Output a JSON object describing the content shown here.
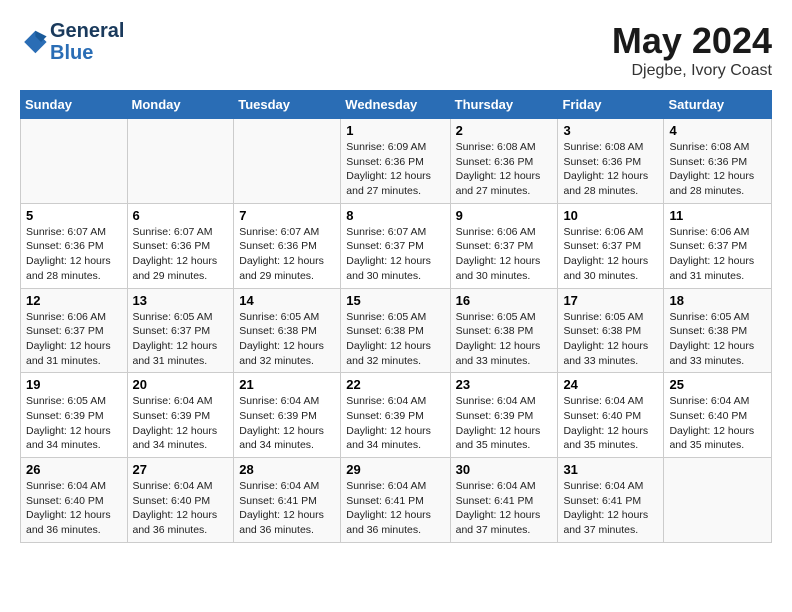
{
  "header": {
    "logo_line1": "General",
    "logo_line2": "Blue",
    "month_title": "May 2024",
    "location": "Djegbe, Ivory Coast"
  },
  "calendar": {
    "weekdays": [
      "Sunday",
      "Monday",
      "Tuesday",
      "Wednesday",
      "Thursday",
      "Friday",
      "Saturday"
    ],
    "weeks": [
      [
        {
          "day": "",
          "info": ""
        },
        {
          "day": "",
          "info": ""
        },
        {
          "day": "",
          "info": ""
        },
        {
          "day": "1",
          "info": "Sunrise: 6:09 AM\nSunset: 6:36 PM\nDaylight: 12 hours\nand 27 minutes."
        },
        {
          "day": "2",
          "info": "Sunrise: 6:08 AM\nSunset: 6:36 PM\nDaylight: 12 hours\nand 27 minutes."
        },
        {
          "day": "3",
          "info": "Sunrise: 6:08 AM\nSunset: 6:36 PM\nDaylight: 12 hours\nand 28 minutes."
        },
        {
          "day": "4",
          "info": "Sunrise: 6:08 AM\nSunset: 6:36 PM\nDaylight: 12 hours\nand 28 minutes."
        }
      ],
      [
        {
          "day": "5",
          "info": "Sunrise: 6:07 AM\nSunset: 6:36 PM\nDaylight: 12 hours\nand 28 minutes."
        },
        {
          "day": "6",
          "info": "Sunrise: 6:07 AM\nSunset: 6:36 PM\nDaylight: 12 hours\nand 29 minutes."
        },
        {
          "day": "7",
          "info": "Sunrise: 6:07 AM\nSunset: 6:36 PM\nDaylight: 12 hours\nand 29 minutes."
        },
        {
          "day": "8",
          "info": "Sunrise: 6:07 AM\nSunset: 6:37 PM\nDaylight: 12 hours\nand 30 minutes."
        },
        {
          "day": "9",
          "info": "Sunrise: 6:06 AM\nSunset: 6:37 PM\nDaylight: 12 hours\nand 30 minutes."
        },
        {
          "day": "10",
          "info": "Sunrise: 6:06 AM\nSunset: 6:37 PM\nDaylight: 12 hours\nand 30 minutes."
        },
        {
          "day": "11",
          "info": "Sunrise: 6:06 AM\nSunset: 6:37 PM\nDaylight: 12 hours\nand 31 minutes."
        }
      ],
      [
        {
          "day": "12",
          "info": "Sunrise: 6:06 AM\nSunset: 6:37 PM\nDaylight: 12 hours\nand 31 minutes."
        },
        {
          "day": "13",
          "info": "Sunrise: 6:05 AM\nSunset: 6:37 PM\nDaylight: 12 hours\nand 31 minutes."
        },
        {
          "day": "14",
          "info": "Sunrise: 6:05 AM\nSunset: 6:38 PM\nDaylight: 12 hours\nand 32 minutes."
        },
        {
          "day": "15",
          "info": "Sunrise: 6:05 AM\nSunset: 6:38 PM\nDaylight: 12 hours\nand 32 minutes."
        },
        {
          "day": "16",
          "info": "Sunrise: 6:05 AM\nSunset: 6:38 PM\nDaylight: 12 hours\nand 33 minutes."
        },
        {
          "day": "17",
          "info": "Sunrise: 6:05 AM\nSunset: 6:38 PM\nDaylight: 12 hours\nand 33 minutes."
        },
        {
          "day": "18",
          "info": "Sunrise: 6:05 AM\nSunset: 6:38 PM\nDaylight: 12 hours\nand 33 minutes."
        }
      ],
      [
        {
          "day": "19",
          "info": "Sunrise: 6:05 AM\nSunset: 6:39 PM\nDaylight: 12 hours\nand 34 minutes."
        },
        {
          "day": "20",
          "info": "Sunrise: 6:04 AM\nSunset: 6:39 PM\nDaylight: 12 hours\nand 34 minutes."
        },
        {
          "day": "21",
          "info": "Sunrise: 6:04 AM\nSunset: 6:39 PM\nDaylight: 12 hours\nand 34 minutes."
        },
        {
          "day": "22",
          "info": "Sunrise: 6:04 AM\nSunset: 6:39 PM\nDaylight: 12 hours\nand 34 minutes."
        },
        {
          "day": "23",
          "info": "Sunrise: 6:04 AM\nSunset: 6:39 PM\nDaylight: 12 hours\nand 35 minutes."
        },
        {
          "day": "24",
          "info": "Sunrise: 6:04 AM\nSunset: 6:40 PM\nDaylight: 12 hours\nand 35 minutes."
        },
        {
          "day": "25",
          "info": "Sunrise: 6:04 AM\nSunset: 6:40 PM\nDaylight: 12 hours\nand 35 minutes."
        }
      ],
      [
        {
          "day": "26",
          "info": "Sunrise: 6:04 AM\nSunset: 6:40 PM\nDaylight: 12 hours\nand 36 minutes."
        },
        {
          "day": "27",
          "info": "Sunrise: 6:04 AM\nSunset: 6:40 PM\nDaylight: 12 hours\nand 36 minutes."
        },
        {
          "day": "28",
          "info": "Sunrise: 6:04 AM\nSunset: 6:41 PM\nDaylight: 12 hours\nand 36 minutes."
        },
        {
          "day": "29",
          "info": "Sunrise: 6:04 AM\nSunset: 6:41 PM\nDaylight: 12 hours\nand 36 minutes."
        },
        {
          "day": "30",
          "info": "Sunrise: 6:04 AM\nSunset: 6:41 PM\nDaylight: 12 hours\nand 37 minutes."
        },
        {
          "day": "31",
          "info": "Sunrise: 6:04 AM\nSunset: 6:41 PM\nDaylight: 12 hours\nand 37 minutes."
        },
        {
          "day": "",
          "info": ""
        }
      ]
    ]
  }
}
